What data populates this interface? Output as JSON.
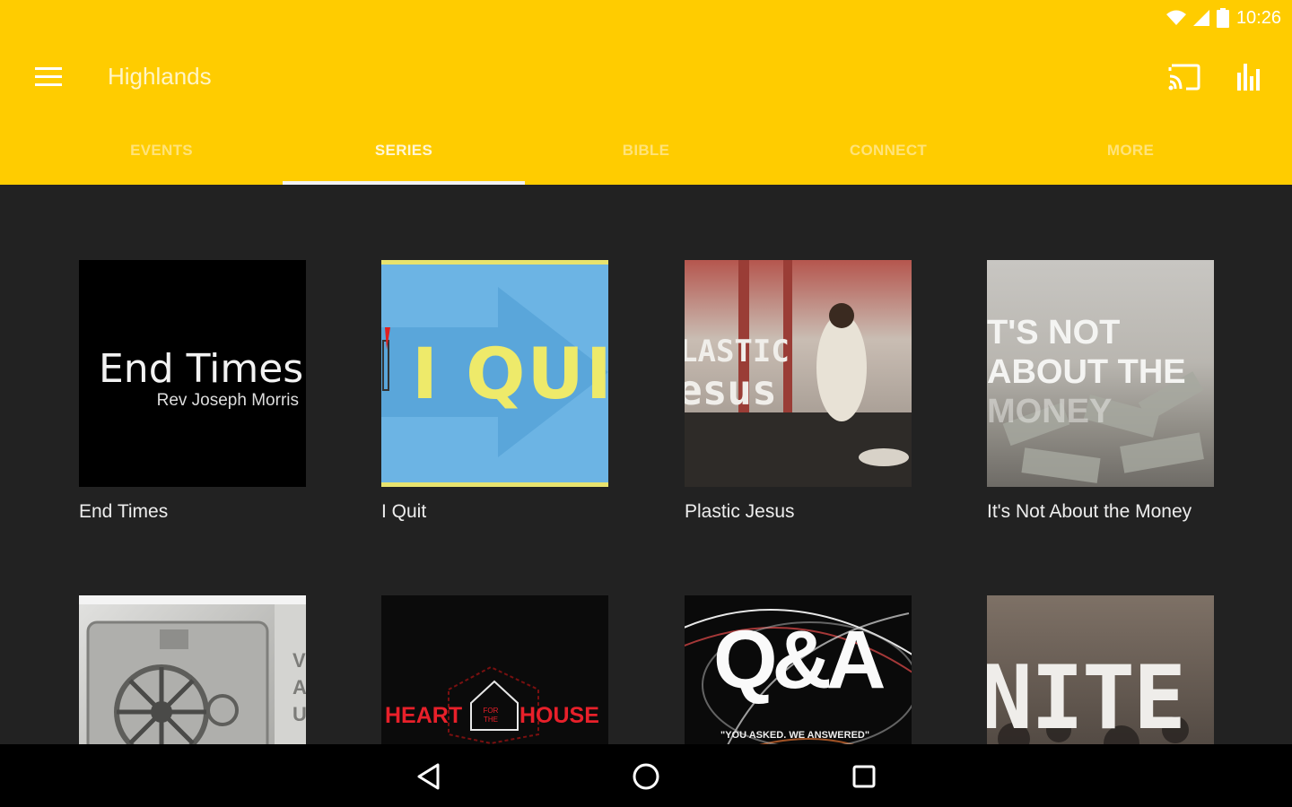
{
  "status": {
    "time": "10:26"
  },
  "toolbar": {
    "title": "Highlands"
  },
  "tabs": [
    {
      "label": "EVENTS"
    },
    {
      "label": "SERIES"
    },
    {
      "label": "BIBLE"
    },
    {
      "label": "CONNECT"
    },
    {
      "label": "MORE"
    }
  ],
  "series": [
    {
      "title": "End Times",
      "art_title": "End Times",
      "art_subtitle": "Rev Joseph Morris"
    },
    {
      "title": "I Quit",
      "art_title": "I QUI"
    },
    {
      "title": "Plastic Jesus",
      "art_line1": "LASTIC",
      "art_line2": "esus"
    },
    {
      "title": "It's Not About the Money",
      "art_line1": "T'S NOT",
      "art_line2": "ABOUT THE",
      "art_line3": "MONEY"
    },
    {
      "title": "",
      "art_letters": "V A U"
    },
    {
      "title": "",
      "art_left": "HEART",
      "art_mid": "FOR THE",
      "art_right": "HOUSE"
    },
    {
      "title": "",
      "art_title": "Q&A",
      "art_caption": "\"YOU ASKED. WE ANSWERED\""
    },
    {
      "title": "",
      "art_title": "NITE"
    }
  ],
  "colors": {
    "accent": "#FFCC00",
    "background": "#222222",
    "navbar": "#000000"
  }
}
